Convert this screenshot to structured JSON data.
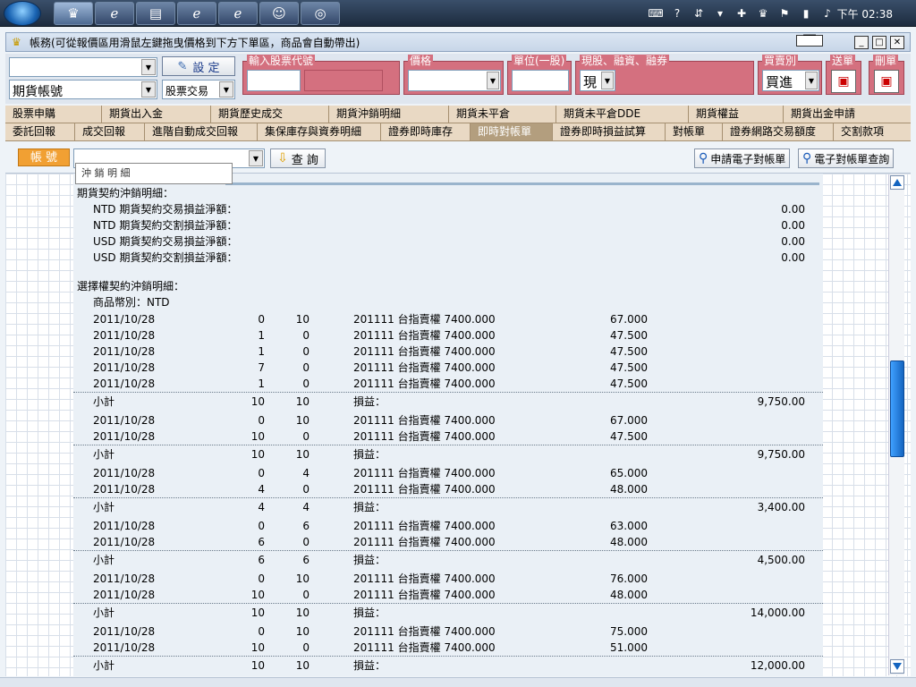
{
  "taskbar": {
    "clock": "下午 02:38"
  },
  "window": {
    "title": "帳務(可從報價區用滑鼠左鍵拖曳價格到下方下單區，商品會自動帶出)"
  },
  "toolbar": {
    "account_type": "期貨帳號",
    "trade_type": "股票交易",
    "set_button": "設 定",
    "labels": {
      "stock_code": "輸入股票代號",
      "price": "價格",
      "unit": "單位(一股)",
      "margin": "現股、融資、融券",
      "buy_sell": "買賣別",
      "send": "送單",
      "delete": "刪單"
    },
    "margin_value": "現",
    "buy_sell_value": "買進"
  },
  "tabs": {
    "row1": [
      "股票申購",
      "期貨出入金",
      "期貨歷史成交",
      "期貨沖銷明細",
      "期貨未平倉",
      "期貨未平倉DDE",
      "期貨權益",
      "期貨出金申請"
    ],
    "row2": [
      "委託回報",
      "成交回報",
      "進階自動成交回報",
      "集保庫存與資券明細",
      "證券即時庫存",
      "即時對帳單",
      "證券即時損益試算",
      "對帳單",
      "證券網路交易額度",
      "交割款項"
    ]
  },
  "filter": {
    "account_label": "帳 號",
    "popup_text": "沖 銷 明 細",
    "query_button": "查 詢",
    "apply_estatement": "申請電子對帳單",
    "query_estatement": "電子對帳單查詢"
  },
  "report": {
    "futures_header": "期貨契約沖銷明細：",
    "futures_items": [
      {
        "label": "NTD 期貨契約交易損益淨額：",
        "value": "0.00"
      },
      {
        "label": "NTD 期貨契約交割損益淨額：",
        "value": "0.00"
      },
      {
        "label": "USD 期貨契約交易損益淨額：",
        "value": "0.00"
      },
      {
        "label": "USD 期貨契約交割損益淨額：",
        "value": "0.00"
      }
    ],
    "options_header": "選擇權契約沖銷明細：",
    "currency_line": "商品幣別：NTD",
    "subtotal_label": "小計",
    "pnl_label": "損益：",
    "groups": [
      {
        "rows": [
          {
            "date": "2011/10/28",
            "a": "0",
            "b": "10",
            "product": "201111 台指賣權 7400.000",
            "price": "67.000"
          },
          {
            "date": "2011/10/28",
            "a": "1",
            "b": "0",
            "product": "201111 台指賣權 7400.000",
            "price": "47.500"
          },
          {
            "date": "2011/10/28",
            "a": "1",
            "b": "0",
            "product": "201111 台指賣權 7400.000",
            "price": "47.500"
          },
          {
            "date": "2011/10/28",
            "a": "7",
            "b": "0",
            "product": "201111 台指賣權 7400.000",
            "price": "47.500"
          },
          {
            "date": "2011/10/28",
            "a": "1",
            "b": "0",
            "product": "201111 台指賣權 7400.000",
            "price": "47.500"
          }
        ],
        "sub_a": "10",
        "sub_b": "10",
        "pnl": "9,750.00"
      },
      {
        "rows": [
          {
            "date": "2011/10/28",
            "a": "0",
            "b": "10",
            "product": "201111 台指賣權 7400.000",
            "price": "67.000"
          },
          {
            "date": "2011/10/28",
            "a": "10",
            "b": "0",
            "product": "201111 台指賣權 7400.000",
            "price": "47.500"
          }
        ],
        "sub_a": "10",
        "sub_b": "10",
        "pnl": "9,750.00"
      },
      {
        "rows": [
          {
            "date": "2011/10/28",
            "a": "0",
            "b": "4",
            "product": "201111 台指賣權 7400.000",
            "price": "65.000"
          },
          {
            "date": "2011/10/28",
            "a": "4",
            "b": "0",
            "product": "201111 台指賣權 7400.000",
            "price": "48.000"
          }
        ],
        "sub_a": "4",
        "sub_b": "4",
        "pnl": "3,400.00"
      },
      {
        "rows": [
          {
            "date": "2011/10/28",
            "a": "0",
            "b": "6",
            "product": "201111 台指賣權 7400.000",
            "price": "63.000"
          },
          {
            "date": "2011/10/28",
            "a": "6",
            "b": "0",
            "product": "201111 台指賣權 7400.000",
            "price": "48.000"
          }
        ],
        "sub_a": "6",
        "sub_b": "6",
        "pnl": "4,500.00"
      },
      {
        "rows": [
          {
            "date": "2011/10/28",
            "a": "0",
            "b": "10",
            "product": "201111 台指賣權 7400.000",
            "price": "76.000"
          },
          {
            "date": "2011/10/28",
            "a": "10",
            "b": "0",
            "product": "201111 台指賣權 7400.000",
            "price": "48.000"
          }
        ],
        "sub_a": "10",
        "sub_b": "10",
        "pnl": "14,000.00"
      },
      {
        "rows": [
          {
            "date": "2011/10/28",
            "a": "0",
            "b": "10",
            "product": "201111 台指賣權 7400.000",
            "price": "75.000"
          },
          {
            "date": "2011/10/28",
            "a": "10",
            "b": "0",
            "product": "201111 台指賣權 7400.000",
            "price": "51.000"
          }
        ],
        "sub_a": "10",
        "sub_b": "10",
        "pnl": "12,000.00"
      }
    ]
  }
}
